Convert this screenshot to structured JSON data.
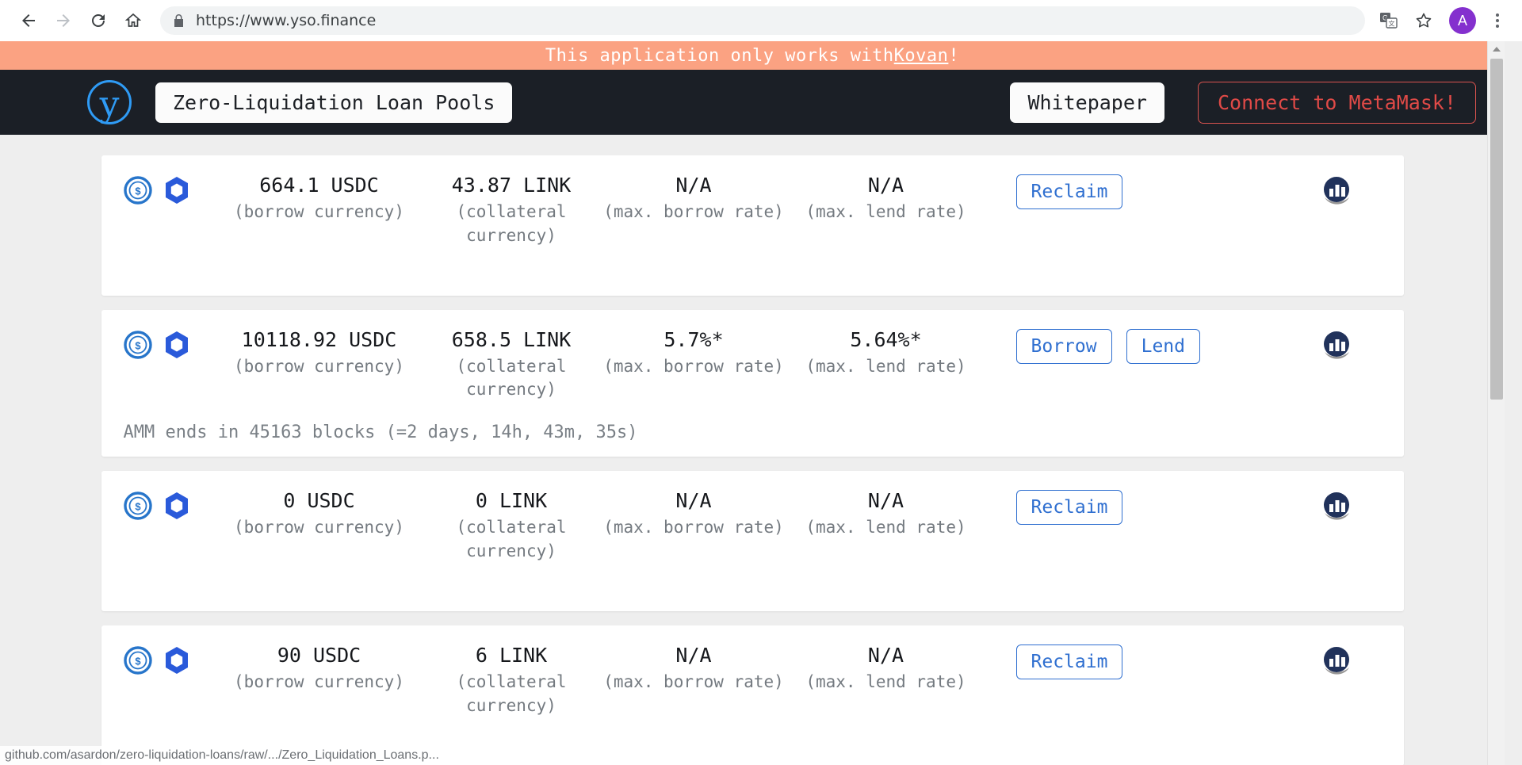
{
  "browser": {
    "back_label": "Back",
    "forward_label": "Forward",
    "reload_label": "Reload",
    "home_label": "Home",
    "url": "https://www.yso.finance",
    "url_placeholder": "Search Google or type a URL",
    "translate_label": "Translate this page",
    "bookmark_label": "Bookmark this tab",
    "avatar_initial": "A",
    "menu_label": "Customize and control Google Chrome",
    "status_text": "github.com/asardon/zero-liquidation-loans/raw/.../Zero_Liquidation_Loans.p..."
  },
  "banner": {
    "prefix": "This application only works with ",
    "link": "Kovan",
    "suffix": "!"
  },
  "header": {
    "logo_letter": "y",
    "title": "Zero-Liquidation Loan Pools",
    "whitepaper_label": "Whitepaper",
    "connect_label": "Connect to MetaMask!"
  },
  "labels": {
    "borrow_currency": "(borrow currency)",
    "collateral_currency": "(collateral currency)",
    "max_borrow_rate": "(max. borrow rate)",
    "max_lend_rate": "(max. lend rate)"
  },
  "colors": {
    "banner_bg": "#fba282",
    "navbar_bg": "#1b1f26",
    "accent_blue": "#2f9bf5",
    "button_blue": "#2f6fd0",
    "metamask_red": "#e04a47",
    "page_bg": "#eeeeee",
    "card_bg": "#ffffff"
  },
  "pools": [
    {
      "borrow_amount": "664.1 USDC",
      "collateral_amount": "43.87 LINK",
      "borrow_rate": "N/A",
      "lend_rate": "N/A",
      "actions": [
        "Reclaim"
      ],
      "amm_note": ""
    },
    {
      "borrow_amount": "10118.92 USDC",
      "collateral_amount": "658.5 LINK",
      "borrow_rate": "5.7%*",
      "lend_rate": "5.64%*",
      "actions": [
        "Borrow",
        "Lend"
      ],
      "amm_note": "AMM ends in 45163 blocks (=2 days, 14h, 43m, 35s)"
    },
    {
      "borrow_amount": "0 USDC",
      "collateral_amount": "0 LINK",
      "borrow_rate": "N/A",
      "lend_rate": "N/A",
      "actions": [
        "Reclaim"
      ],
      "amm_note": ""
    },
    {
      "borrow_amount": "90 USDC",
      "collateral_amount": "6 LINK",
      "borrow_rate": "N/A",
      "lend_rate": "N/A",
      "actions": [
        "Reclaim"
      ],
      "amm_note": ""
    }
  ]
}
